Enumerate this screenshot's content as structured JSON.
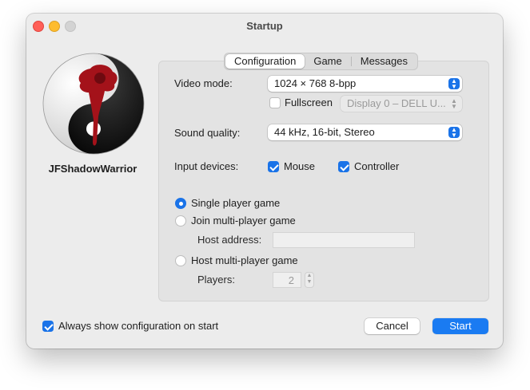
{
  "window": {
    "title": "Startup"
  },
  "app": {
    "name": "JFShadowWarrior"
  },
  "tabs": [
    {
      "label": "Configuration",
      "active": true
    },
    {
      "label": "Game",
      "active": false
    },
    {
      "label": "Messages",
      "active": false
    }
  ],
  "config": {
    "video_mode": {
      "label": "Video mode:",
      "value": "1024 × 768 8-bpp"
    },
    "fullscreen": {
      "label": "Fullscreen",
      "checked": false,
      "display_value": "Display 0 – DELL U..."
    },
    "sound_quality": {
      "label": "Sound quality:",
      "value": "44 kHz, 16-bit, Stereo"
    },
    "input_devices": {
      "label": "Input devices:",
      "mouse": {
        "label": "Mouse",
        "checked": true
      },
      "controller": {
        "label": "Controller",
        "checked": true
      }
    },
    "game_mode": {
      "single": {
        "label": "Single player game",
        "selected": true
      },
      "join": {
        "label": "Join multi-player game",
        "selected": false
      },
      "host_address_label": "Host address:",
      "host_address_value": "",
      "host": {
        "label": "Host multi-player game",
        "selected": false
      },
      "players_label": "Players:",
      "players_value": "2"
    }
  },
  "footer": {
    "always_show": {
      "label": "Always show configuration on start",
      "checked": true
    },
    "cancel_label": "Cancel",
    "start_label": "Start"
  },
  "colors": {
    "accent": "#1a73e8",
    "window_bg": "#ececec"
  }
}
